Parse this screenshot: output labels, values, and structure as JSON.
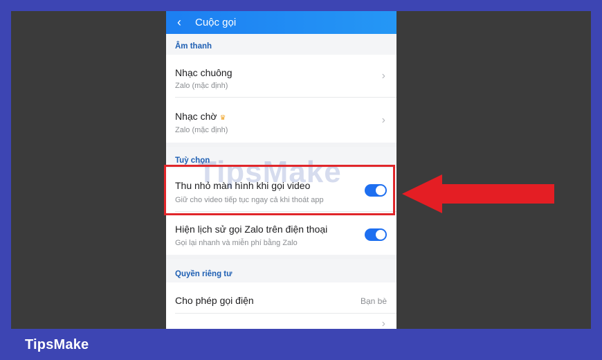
{
  "brand": "TipsMake",
  "watermark": "TipsMake",
  "header": {
    "title": "Cuộc gọi"
  },
  "sections": {
    "sound": {
      "title": "Âm thanh",
      "items": [
        {
          "title": "Nhạc chuông",
          "subtitle": "Zalo (mặc định)"
        },
        {
          "title": "Nhạc chờ",
          "subtitle": "Zalo (mặc định)",
          "premium": true
        }
      ]
    },
    "options": {
      "title": "Tuỳ chọn",
      "items": [
        {
          "title": "Thu nhỏ màn hình khi gọi video",
          "subtitle": "Giữ cho video tiếp tục ngay cả khi thoát app",
          "toggle_on": true
        },
        {
          "title": "Hiện lịch sử gọi Zalo trên điện thoại",
          "subtitle": "Gọi lại nhanh và miễn phí bằng Zalo",
          "toggle_on": true
        }
      ]
    },
    "privacy": {
      "title": "Quyền riêng tư",
      "items": [
        {
          "title": "Cho phép gọi điện",
          "value": "Bạn bè"
        }
      ]
    }
  },
  "colors": {
    "accent": "#1e6ff0",
    "highlight": "#e0262a",
    "frame": "#3d45b3"
  }
}
